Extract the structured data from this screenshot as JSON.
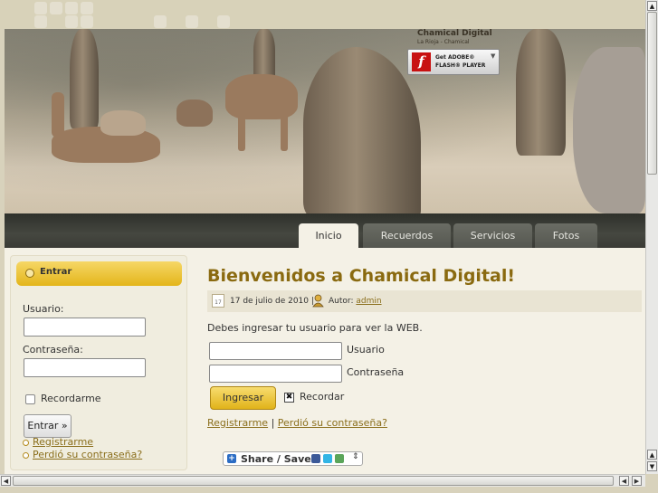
{
  "brand": {
    "title": "Chamical Digital",
    "subtitle": "La Rioja - Chamical"
  },
  "flash_badge": {
    "get": "Get ADOBE®",
    "player": "FLASH® PLAYER",
    "logo": "f"
  },
  "nav": {
    "tabs": [
      {
        "label": "Inicio",
        "active": true
      },
      {
        "label": "Recuerdos",
        "active": false
      },
      {
        "label": "Servicios",
        "active": false
      },
      {
        "label": "Fotos",
        "active": false
      }
    ]
  },
  "login_panel": {
    "title": "Entrar",
    "username_label": "Usuario:",
    "password_label": "Contraseña:",
    "remember_label": "Recordarme",
    "submit_label": "Entrar »",
    "links": [
      "Registrarme",
      "Perdió su contraseña?"
    ]
  },
  "article": {
    "title": "Bienvenidos a Chamical Digital!",
    "date": "17 de julio de 2010 |",
    "calendar_day": "17",
    "author_prefix": "Autor:",
    "author": "admin",
    "notice": "Debes ingresar tu usuario para ver la WEB.",
    "username_label": "Usuario",
    "password_label": "Contraseña",
    "submit_label": "Ingresar",
    "remember_label": "Recordar",
    "remember_checked": true,
    "register_link": "Registrarme",
    "separator": "|",
    "forgot_link": "Perdió su contraseña?",
    "share_label": "Share / Save"
  },
  "colors": {
    "accent_gold": "#e3b51a",
    "link": "#8a6e1b",
    "nav_dark": "#3a3b35",
    "content_bg": "#f4f1e6"
  },
  "icons": [
    "flash-player-icon",
    "bullet-icon",
    "calendar-icon",
    "author-icon",
    "share-plus-icon",
    "facebook-icon",
    "twitter-icon",
    "email-icon"
  ]
}
